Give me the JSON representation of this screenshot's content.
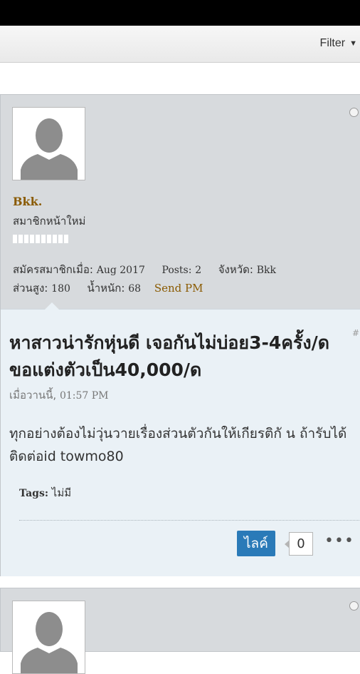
{
  "filter": {
    "label": "Filter",
    "icon": "caret-down-icon"
  },
  "post": {
    "username": "Bkk.",
    "user_title": "สมาชิกหน้าใหม่",
    "reputation_blocks": 10,
    "meta": {
      "joined_label": "สมัครสมาชิกเมื่อ:",
      "joined_value": "Aug 2017",
      "posts_label": "Posts:",
      "posts_value": "2",
      "province_label": "จังหวัด:",
      "province_value": "Bkk",
      "height_label": "ส่วนสูง:",
      "height_value": "180",
      "weight_label": "น้ำหนัก:",
      "weight_value": "68"
    },
    "send_pm": "Send PM",
    "post_number": "#",
    "title": "หาสาวน่ารักหุ่นดี เจอกันไม่บ่อย3-4ครั้ง/ด ขอแต่งตัวเป็น40,000/ด",
    "date_label": "เมื่อวานนี้,",
    "date_time": "01:57 PM",
    "body": "ทุกอย่างต้องไม่วุ่นวายเรื่องส่วนตัวกันให้เกียรติกั น ถ้ารับได้ติดต่อid towmo80",
    "tags_label": "Tags:",
    "tags_value": "ไม่มี",
    "like_label": "ไลค์",
    "like_count": "0"
  }
}
